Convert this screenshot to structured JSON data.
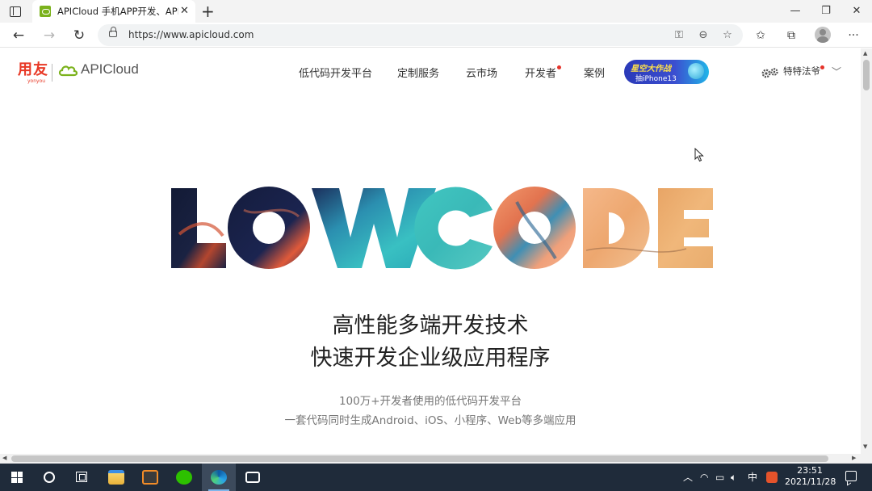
{
  "browser": {
    "tab_title": "APICloud 手机APP开发、APP制作",
    "tab_close": "✕",
    "new_tab": "+",
    "url": "https://www.apicloud.com",
    "window_controls": {
      "minimize": "—",
      "maximize": "❐",
      "close": "✕"
    },
    "nav": {
      "back": "←",
      "forward": "→",
      "refresh": "↻"
    },
    "url_icons": {
      "key": "⚿",
      "zoom": "⊖",
      "favorite": "☆"
    },
    "toolbar_icons": {
      "favorites": "✩",
      "collections": "⧉",
      "more": "···"
    }
  },
  "site": {
    "logo_yonyou": "用友",
    "logo_yonyou_sub": "yonyou",
    "brand": "APICloud",
    "nav": [
      "低代码开发平台",
      "定制服务",
      "云市场",
      "开发者",
      "案例"
    ],
    "promo_line1": "星空大作战",
    "promo_line2": "抽iPhone13",
    "user_name": "特特法爷",
    "user_chevron": "﹀"
  },
  "hero": {
    "art_text": "LOWCODE",
    "headline_line1": "高性能多端开发技术",
    "headline_line2": "快速开发企业级应用程序",
    "sub_line1": "100万+开发者使用的低代码开发平台",
    "sub_line2": "一套代码同时生成Android、iOS、小程序、Web等多端应用"
  },
  "taskbar": {
    "tray_chevron": "︿",
    "ime": "中",
    "time": "23:51",
    "date": "2021/11/28"
  },
  "colors": {
    "brand_red": "#e83825",
    "brand_green": "#7bb21c",
    "taskbar": "#1f2b3a"
  }
}
